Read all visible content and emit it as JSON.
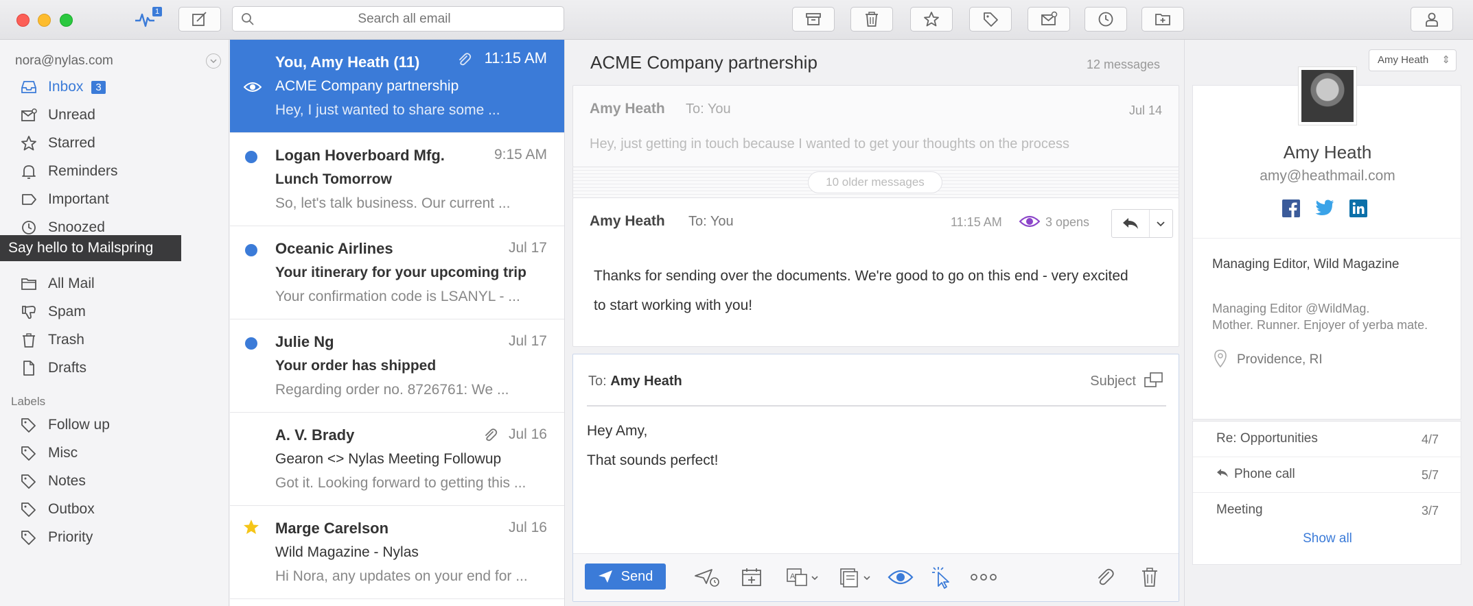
{
  "search": {
    "placeholder": "Search all email"
  },
  "activity": {
    "badge": "1"
  },
  "sidebar": {
    "account": "nora@nylas.com",
    "folders": [
      {
        "label": "Inbox",
        "count": "3",
        "icon": "inbox-icon"
      },
      {
        "label": "Unread",
        "icon": "unread-icon"
      },
      {
        "label": "Starred",
        "icon": "star-icon"
      },
      {
        "label": "Reminders",
        "icon": "bell-icon"
      },
      {
        "label": "Important",
        "icon": "important-tag-icon"
      },
      {
        "label": "Snoozed",
        "icon": "clock-icon"
      },
      {
        "label": "All Mail",
        "icon": "folder-icon"
      },
      {
        "label": "Spam",
        "icon": "thumbs-down-icon"
      },
      {
        "label": "Trash",
        "icon": "trash-icon"
      },
      {
        "label": "Drafts",
        "icon": "draft-icon"
      }
    ],
    "labels_heading": "Labels",
    "labels": [
      {
        "label": "Follow up"
      },
      {
        "label": "Misc"
      },
      {
        "label": "Notes"
      },
      {
        "label": "Outbox"
      },
      {
        "label": "Priority"
      }
    ],
    "tooltip": "Say hello to Mailspring"
  },
  "messages": [
    {
      "from": "You, Amy Heath (11)",
      "date": "11:15 AM",
      "subject": "ACME Company partnership",
      "snippet": "Hey, I just wanted to share some ..."
    },
    {
      "from": "Logan Hoverboard Mfg.",
      "date": "9:15 AM",
      "subject": "Lunch Tomorrow",
      "snippet": "So, let's talk business. Our current ..."
    },
    {
      "from": "Oceanic Airlines",
      "date": "Jul 17",
      "subject": "Your itinerary for your upcoming trip",
      "snippet": "Your confirmation code is LSANYL - ..."
    },
    {
      "from": "Julie Ng",
      "date": "Jul 17",
      "subject": "Your order has shipped",
      "snippet": "Regarding order no. 8726761: We ..."
    },
    {
      "from": "A. V. Brady",
      "date": "Jul 16",
      "subject": "Gearon <> Nylas Meeting Followup",
      "snippet": "Got it. Looking forward to getting this ..."
    },
    {
      "from": "Marge Carelson",
      "date": "Jul 16",
      "subject": "Wild Magazine - Nylas",
      "snippet": "Hi Nora, any updates on your end for ..."
    }
  ],
  "thread": {
    "title": "ACME Company partnership",
    "count": "12 messages",
    "collapsed": {
      "sender": "Amy Heath",
      "to": "To: You",
      "date": "Jul 14",
      "preview": "Hey, just getting in touch because I wanted to get your thoughts on the process"
    },
    "older": "10 older messages",
    "expanded": {
      "sender": "Amy Heath",
      "to": "To: You",
      "time": "11:15 AM",
      "opens": "3 opens",
      "body": "Thanks for sending over the documents. We're good to go on this end - very excited to start working with you!"
    }
  },
  "composer": {
    "to_label": "To:",
    "to_name": "Amy Heath",
    "subject_label": "Subject",
    "line1": "Hey Amy,",
    "line2": "That sounds perfect!",
    "send_label": "Send"
  },
  "contact": {
    "selector": "Amy Heath",
    "name": "Amy Heath",
    "email": "amy@heathmail.com",
    "role": "Managing Editor, Wild Magazine",
    "bio1": "Managing Editor @WildMag.",
    "bio2": "Mother. Runner. Enjoyer of yerba mate.",
    "location": "Providence, RI",
    "threads": [
      {
        "title": "Re: Opportunities",
        "count": "4/7"
      },
      {
        "title": "Phone call",
        "count": "5/7"
      },
      {
        "title": "Meeting",
        "count": "3/7"
      }
    ],
    "show_all": "Show all"
  },
  "colors": {
    "accent": "#3b7bd8",
    "tracking": "#8b44c9"
  }
}
